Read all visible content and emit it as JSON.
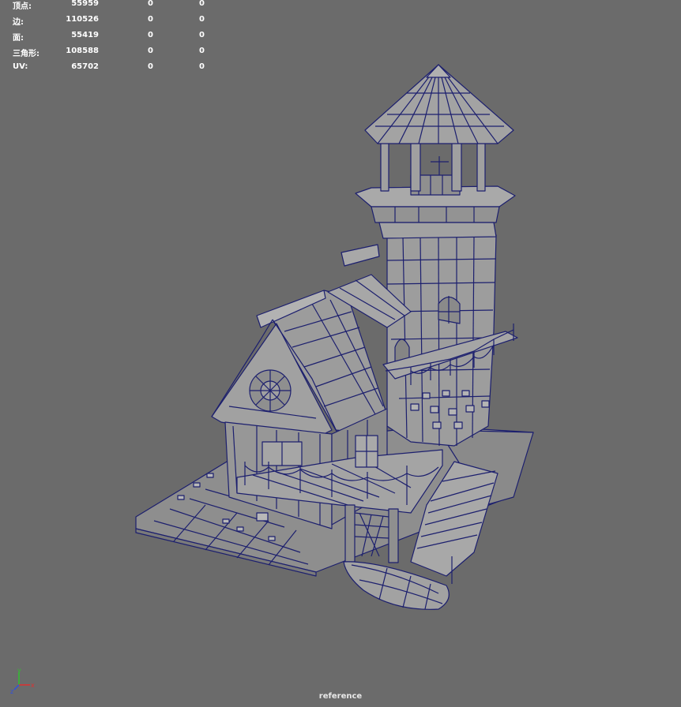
{
  "heads_up_display": {
    "rows": [
      {
        "label": "顶点:",
        "values": [
          "55959",
          "0",
          "0"
        ]
      },
      {
        "label": "边:",
        "values": [
          "110526",
          "0",
          "0"
        ]
      },
      {
        "label": "面:",
        "values": [
          "55419",
          "0",
          "0"
        ]
      },
      {
        "label": "三角形:",
        "values": [
          "108588",
          "0",
          "0"
        ]
      },
      {
        "label": "UV:",
        "values": [
          "65702",
          "0",
          "0"
        ]
      }
    ]
  },
  "viewport": {
    "camera_name": "reference",
    "background_color": "#6b6b6b",
    "wireframe_color": "#1c1f6e",
    "mesh_color": "#9a9a9a"
  },
  "axis_gizmo": {
    "labels": [
      "y",
      "z",
      "x"
    ],
    "colors": {
      "x": "#e03030",
      "y": "#30c030",
      "z": "#3050e0"
    }
  }
}
